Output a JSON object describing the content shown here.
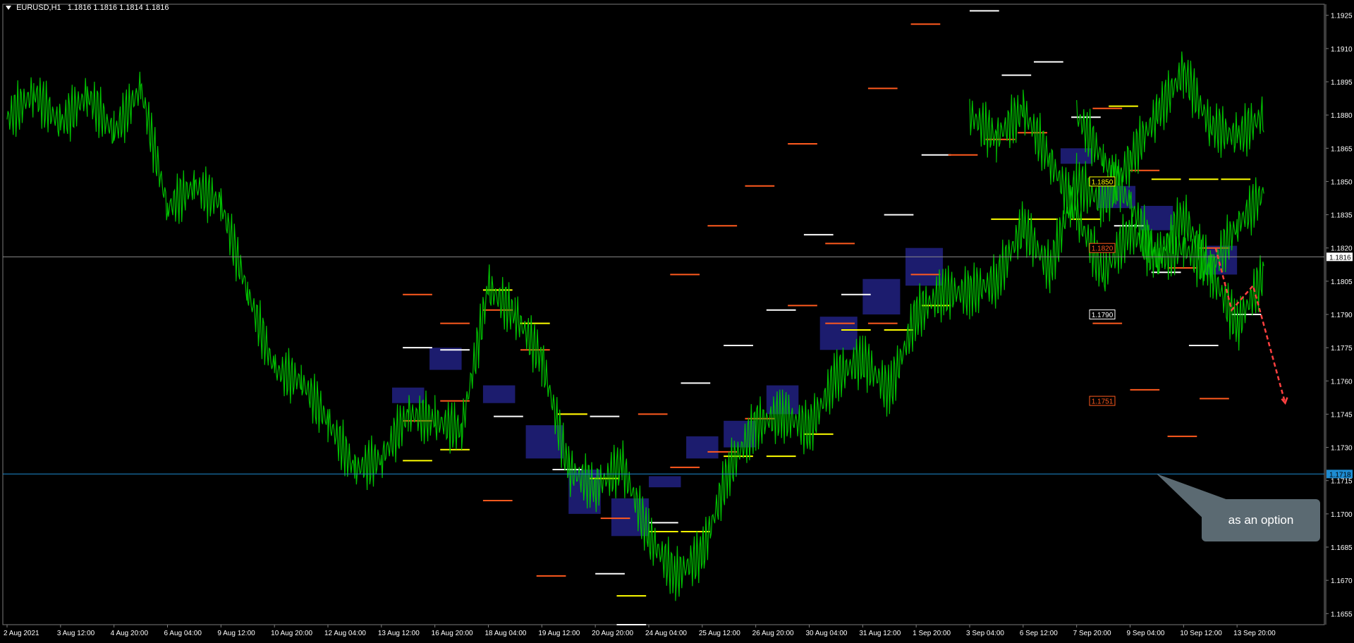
{
  "chart_title": {
    "symbol": "EURUSD,H1",
    "ohlc": "1.1816 1.1816 1.1814 1.1816"
  },
  "annotation": {
    "callout_text": "as an option"
  },
  "colors": {
    "background": "#000000",
    "candles": "#00c000",
    "axis_text": "#ffffff",
    "level_white": "#ffffff",
    "level_orange": "#ff5a1e",
    "level_yellow": "#ffff00",
    "zone": "#1c1c6e",
    "bid_line": "#8c8c8c",
    "support_line": "#1e8cd2",
    "arrow": "#ff4040",
    "callout": "#5b6a72"
  },
  "chart_data": {
    "type": "line",
    "title": "EURUSD,H1",
    "ylim": [
      1.165,
      1.193
    ],
    "y_ticks": [
      "1.1925",
      "1.1910",
      "1.1895",
      "1.1880",
      "1.1865",
      "1.1850",
      "1.1835",
      "1.1820",
      "1.1805",
      "1.1790",
      "1.1775",
      "1.1760",
      "1.1745",
      "1.1730",
      "1.1715",
      "1.1700",
      "1.1685",
      "1.1670",
      "1.1655"
    ],
    "x_ticks": [
      "2 Aug 2021",
      "3 Aug 12:00",
      "4 Aug 20:00",
      "6 Aug 04:00",
      "9 Aug 12:00",
      "10 Aug 20:00",
      "12 Aug 04:00",
      "13 Aug 12:00",
      "16 Aug 20:00",
      "18 Aug 04:00",
      "19 Aug 12:00",
      "20 Aug 20:00",
      "24 Aug 04:00",
      "25 Aug 12:00",
      "26 Aug 20:00",
      "30 Aug 04:00",
      "31 Aug 12:00",
      "1 Sep 20:00",
      "3 Sep 04:00",
      "6 Sep 12:00",
      "7 Sep 20:00",
      "9 Sep 04:00",
      "10 Sep 12:00",
      "13 Sep 20:00"
    ],
    "grid": false,
    "series": [
      {
        "x": [
          0,
          0.5,
          1,
          1.5,
          2,
          2.5,
          3,
          3.5,
          4,
          4.5,
          5,
          5.5,
          6,
          6.5,
          7,
          7.5,
          8,
          8.5,
          9,
          9.5,
          10,
          10.5,
          11,
          11.5,
          12,
          12.5,
          13,
          13.5,
          14,
          14.5,
          15,
          15.5,
          16,
          16.5,
          17,
          17.5,
          18,
          18.5,
          19,
          19.5,
          20,
          20.5,
          21,
          21.5,
          22,
          22.5,
          23,
          23.5
        ],
        "values": [
          1.1878,
          1.189,
          1.1876,
          1.1889,
          1.1872,
          1.1892,
          1.1838,
          1.1848,
          1.184,
          1.18,
          1.1765,
          1.176,
          1.1742,
          1.172,
          1.1725,
          1.1745,
          1.1742,
          1.1738,
          1.1802,
          1.179,
          1.177,
          1.172,
          1.1712,
          1.1722,
          1.169,
          1.1672,
          1.1682,
          1.172,
          1.174,
          1.1745,
          1.1738,
          1.1762,
          1.177,
          1.1755,
          1.179,
          1.18,
          1.18,
          1.1805,
          1.183,
          1.181,
          1.185,
          1.184,
          1.186,
          1.188,
          1.19,
          1.1875,
          1.187,
          1.188
        ]
      },
      {
        "x": [
          20,
          20.5,
          21,
          21.5,
          22,
          22.5,
          23,
          23.5
        ],
        "values": [
          1.188,
          1.186,
          1.184,
          1.1815,
          1.182,
          1.181,
          1.183,
          1.1845
        ]
      },
      {
        "x": [
          18,
          18.5,
          19,
          19.5,
          20,
          20.5,
          21,
          21.5,
          22,
          22.5,
          23,
          23.5
        ],
        "values": [
          1.188,
          1.187,
          1.1882,
          1.186,
          1.1835,
          1.1808,
          1.1828,
          1.1815,
          1.1835,
          1.181,
          1.1785,
          1.1808
        ]
      }
    ],
    "price_levels": {
      "white": [
        [
          7.4,
          1.1775
        ],
        [
          8.1,
          1.1774
        ],
        [
          9.1,
          1.1744
        ],
        [
          10.2,
          1.172
        ],
        [
          10.9,
          1.1744
        ],
        [
          11.0,
          1.1673
        ],
        [
          11.4,
          1.165
        ],
        [
          12.0,
          1.1696
        ],
        [
          12.6,
          1.1759
        ],
        [
          13.4,
          1.1776
        ],
        [
          14.2,
          1.1792
        ],
        [
          14.9,
          1.1826
        ],
        [
          15.6,
          1.1799
        ],
        [
          16.4,
          1.1835
        ],
        [
          17.1,
          1.1862
        ],
        [
          18.0,
          1.1927
        ],
        [
          18.6,
          1.1898
        ],
        [
          19.2,
          1.1904
        ],
        [
          19.9,
          1.1879
        ],
        [
          20.7,
          1.183
        ],
        [
          21.4,
          1.1809
        ],
        [
          22.1,
          1.1776
        ],
        [
          22.9,
          1.179
        ]
      ],
      "orange": [
        [
          7.4,
          1.1799
        ],
        [
          7.4,
          1.1742
        ],
        [
          8.1,
          1.1786
        ],
        [
          8.1,
          1.1751
        ],
        [
          8.9,
          1.1792
        ],
        [
          8.9,
          1.1706
        ],
        [
          9.6,
          1.1774
        ],
        [
          9.9,
          1.1672
        ],
        [
          10.3,
          1.1745
        ],
        [
          11.1,
          1.1698
        ],
        [
          11.8,
          1.1745
        ],
        [
          12.4,
          1.1808
        ],
        [
          12.4,
          1.1721
        ],
        [
          13.1,
          1.183
        ],
        [
          13.1,
          1.1728
        ],
        [
          13.8,
          1.1848
        ],
        [
          13.8,
          1.1743
        ],
        [
          14.6,
          1.1867
        ],
        [
          14.6,
          1.1794
        ],
        [
          15.3,
          1.1822
        ],
        [
          15.3,
          1.1786
        ],
        [
          16.1,
          1.1892
        ],
        [
          16.1,
          1.1786
        ],
        [
          16.9,
          1.1921
        ],
        [
          16.9,
          1.1808
        ],
        [
          17.6,
          1.1862
        ],
        [
          18.3,
          1.1869
        ],
        [
          18.9,
          1.1872
        ],
        [
          20.3,
          1.1883
        ],
        [
          20.3,
          1.1786
        ],
        [
          21.0,
          1.1855
        ],
        [
          21.0,
          1.1756
        ],
        [
          21.7,
          1.1811
        ],
        [
          21.7,
          1.1735
        ],
        [
          22.3,
          1.182
        ],
        [
          22.3,
          1.1752
        ]
      ],
      "yellow": [
        [
          7.4,
          1.1724
        ],
        [
          8.1,
          1.1729
        ],
        [
          8.9,
          1.1801
        ],
        [
          9.6,
          1.1786
        ],
        [
          10.3,
          1.1745
        ],
        [
          10.9,
          1.1716
        ],
        [
          11.4,
          1.1663
        ],
        [
          12.0,
          1.1692
        ],
        [
          12.6,
          1.1692
        ],
        [
          13.4,
          1.1726
        ],
        [
          14.2,
          1.1726
        ],
        [
          14.9,
          1.1736
        ],
        [
          15.6,
          1.1783
        ],
        [
          16.4,
          1.1783
        ],
        [
          17.1,
          1.1794
        ],
        [
          18.4,
          1.1833
        ],
        [
          19.1,
          1.1833
        ],
        [
          19.9,
          1.1833
        ],
        [
          20.6,
          1.1884
        ],
        [
          21.4,
          1.1851
        ],
        [
          22.1,
          1.1851
        ],
        [
          22.7,
          1.1851
        ]
      ]
    },
    "zones": [
      [
        7.2,
        7.8,
        1.175,
        1.1757
      ],
      [
        7.9,
        8.5,
        1.1765,
        1.1775
      ],
      [
        8.9,
        9.5,
        1.175,
        1.1758
      ],
      [
        9.7,
        10.4,
        1.1725,
        1.174
      ],
      [
        10.5,
        11.1,
        1.17,
        1.172
      ],
      [
        11.3,
        12.0,
        1.169,
        1.1707
      ],
      [
        12.0,
        12.6,
        1.1712,
        1.1717
      ],
      [
        12.7,
        13.3,
        1.1725,
        1.1735
      ],
      [
        13.4,
        14.0,
        1.173,
        1.1742
      ],
      [
        14.2,
        14.8,
        1.1745,
        1.1758
      ],
      [
        15.2,
        15.9,
        1.1774,
        1.1789
      ],
      [
        16.0,
        16.7,
        1.179,
        1.1806
      ],
      [
        16.8,
        17.5,
        1.1803,
        1.182
      ],
      [
        19.7,
        20.3,
        1.1858,
        1.1865
      ],
      [
        20.4,
        21.1,
        1.1838,
        1.1848
      ],
      [
        21.2,
        21.8,
        1.1828,
        1.1839
      ],
      [
        22.4,
        23.0,
        1.1808,
        1.1821
      ]
    ],
    "bid_price": 1.1816,
    "bid_label": "1.1816",
    "support_level": 1.1718,
    "support_label": "1.1718",
    "target_labels": [
      {
        "label": "1.1850",
        "value": 1.185,
        "color": "#ffff00"
      },
      {
        "label": "1.1820",
        "value": 1.182,
        "color": "#ff5a1e"
      },
      {
        "label": "1.1790",
        "value": 1.179,
        "color": "#ffffff"
      },
      {
        "label": "1.1751",
        "value": 1.1751,
        "color": "#ff5a1e"
      }
    ],
    "projection": {
      "x": [
        22.6,
        22.9,
        23.3,
        23.9
      ],
      "values": [
        1.182,
        1.1792,
        1.1803,
        1.175
      ]
    }
  }
}
